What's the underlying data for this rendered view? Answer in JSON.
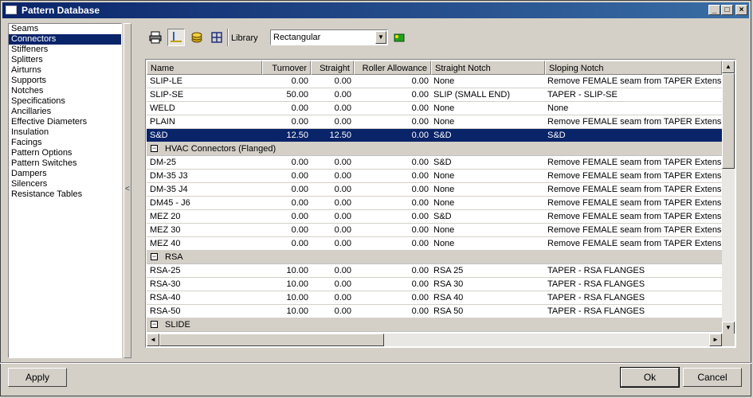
{
  "window": {
    "title": "Pattern Database",
    "min": "_",
    "max": "□",
    "close": "×"
  },
  "sidebar": {
    "items": [
      "Seams",
      "Connectors",
      "Stiffeners",
      "Splitters",
      "Airturns",
      "Supports",
      "Notches",
      "Specifications",
      "Ancillaries",
      "Effective Diameters",
      "Insulation",
      "Facings",
      "Pattern Options",
      "Pattern Switches",
      "Dampers",
      "Silencers",
      "Resistance Tables"
    ],
    "selected": "Connectors"
  },
  "splitter": {
    "glyph": "<"
  },
  "toolbar": {
    "icons": [
      "printer-icon",
      "pin-icon",
      "stack-icon",
      "grid-icon",
      "flag-icon"
    ],
    "library_label": "Library",
    "library_value": "Rectangular"
  },
  "grid": {
    "columns": [
      "Name",
      "Turnover",
      "Straight",
      "Roller Allowance",
      "Straight Notch",
      "Sloping Notch"
    ],
    "rows": [
      {
        "type": "row",
        "name": "SLIP-LE",
        "turnover": "0.00",
        "straight": "0.00",
        "roller": "0.00",
        "straight_notch": "None",
        "sloping_notch": "Remove FEMALE seam from TAPER Extension"
      },
      {
        "type": "row",
        "name": "SLIP-SE",
        "turnover": "50.00",
        "straight": "0.00",
        "roller": "0.00",
        "straight_notch": "SLIP (SMALL END)",
        "sloping_notch": "TAPER - SLIP-SE"
      },
      {
        "type": "row",
        "name": "WELD",
        "turnover": "0.00",
        "straight": "0.00",
        "roller": "0.00",
        "straight_notch": "None",
        "sloping_notch": "None"
      },
      {
        "type": "row",
        "name": "PLAIN",
        "turnover": "0.00",
        "straight": "0.00",
        "roller": "0.00",
        "straight_notch": "None",
        "sloping_notch": "Remove FEMALE seam from TAPER Extension"
      },
      {
        "type": "row",
        "name": "S&D",
        "turnover": "12.50",
        "straight": "12.50",
        "roller": "0.00",
        "straight_notch": "S&D",
        "sloping_notch": "S&D",
        "selected": true
      },
      {
        "type": "group",
        "label": "HVAC Connectors (Flanged)"
      },
      {
        "type": "row",
        "name": "DM-25",
        "turnover": "0.00",
        "straight": "0.00",
        "roller": "0.00",
        "straight_notch": "S&D",
        "sloping_notch": "Remove FEMALE seam from TAPER Extension"
      },
      {
        "type": "row",
        "name": "DM-35 J3",
        "turnover": "0.00",
        "straight": "0.00",
        "roller": "0.00",
        "straight_notch": "None",
        "sloping_notch": "Remove FEMALE seam from TAPER Extension"
      },
      {
        "type": "row",
        "name": "DM-35 J4",
        "turnover": "0.00",
        "straight": "0.00",
        "roller": "0.00",
        "straight_notch": "None",
        "sloping_notch": "Remove FEMALE seam from TAPER Extension"
      },
      {
        "type": "row",
        "name": "DM45 - J6",
        "turnover": "0.00",
        "straight": "0.00",
        "roller": "0.00",
        "straight_notch": "None",
        "sloping_notch": "Remove FEMALE seam from TAPER Extension"
      },
      {
        "type": "row",
        "name": "MEZ 20",
        "turnover": "0.00",
        "straight": "0.00",
        "roller": "0.00",
        "straight_notch": "S&D",
        "sloping_notch": "Remove FEMALE seam from TAPER Extension"
      },
      {
        "type": "row",
        "name": "MEZ 30",
        "turnover": "0.00",
        "straight": "0.00",
        "roller": "0.00",
        "straight_notch": "None",
        "sloping_notch": "Remove FEMALE seam from TAPER Extension"
      },
      {
        "type": "row",
        "name": "MEZ 40",
        "turnover": "0.00",
        "straight": "0.00",
        "roller": "0.00",
        "straight_notch": "None",
        "sloping_notch": "Remove FEMALE seam from TAPER Extension"
      },
      {
        "type": "group",
        "label": "RSA"
      },
      {
        "type": "row",
        "name": "RSA-25",
        "turnover": "10.00",
        "straight": "0.00",
        "roller": "0.00",
        "straight_notch": "RSA 25",
        "sloping_notch": "TAPER - RSA FLANGES"
      },
      {
        "type": "row",
        "name": "RSA-30",
        "turnover": "10.00",
        "straight": "0.00",
        "roller": "0.00",
        "straight_notch": "RSA 30",
        "sloping_notch": "TAPER - RSA FLANGES"
      },
      {
        "type": "row",
        "name": "RSA-40",
        "turnover": "10.00",
        "straight": "0.00",
        "roller": "0.00",
        "straight_notch": "RSA 40",
        "sloping_notch": "TAPER - RSA FLANGES"
      },
      {
        "type": "row",
        "name": "RSA-50",
        "turnover": "10.00",
        "straight": "0.00",
        "roller": "0.00",
        "straight_notch": "RSA 50",
        "sloping_notch": "TAPER - RSA FLANGES"
      },
      {
        "type": "group",
        "label": "SLIDE"
      }
    ],
    "group_toggle": "−",
    "scroll_up": "▲",
    "scroll_down": "▼",
    "scroll_left": "◄",
    "scroll_right": "►"
  },
  "footer": {
    "apply": "Apply",
    "ok": "Ok",
    "cancel": "Cancel"
  }
}
